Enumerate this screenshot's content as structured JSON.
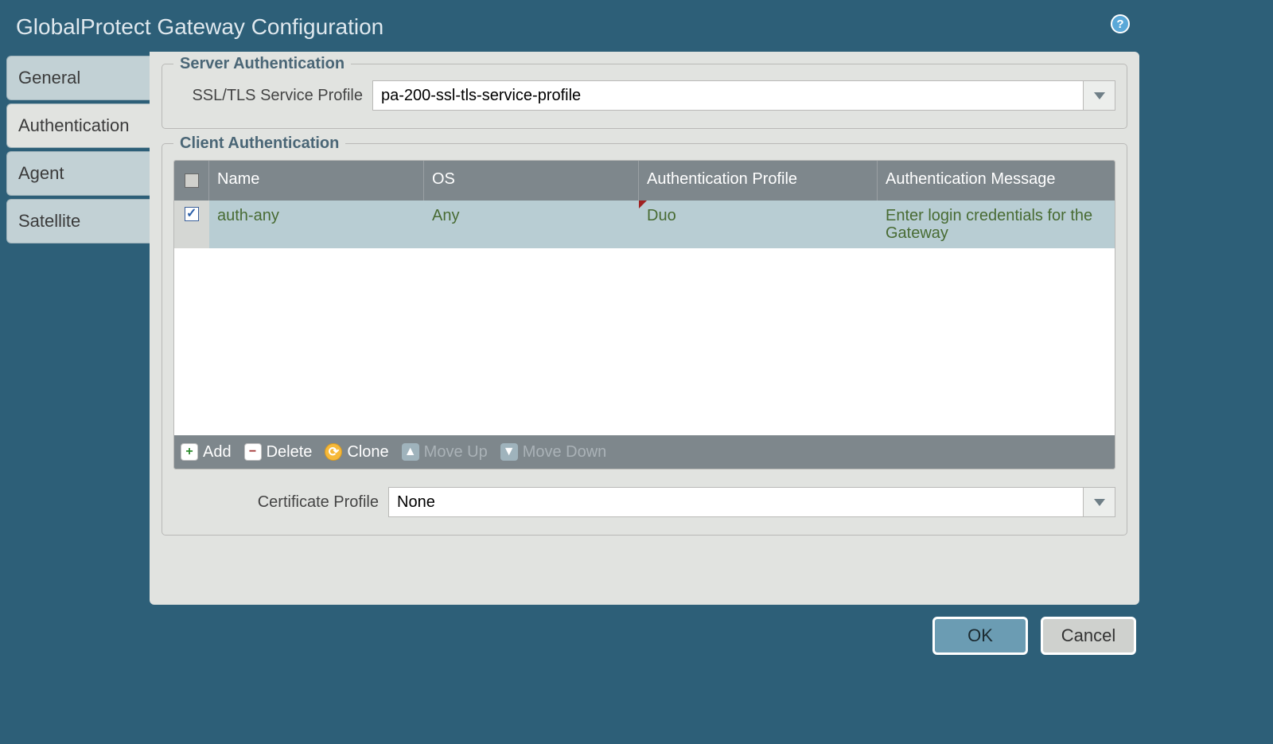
{
  "title": "GlobalProtect Gateway Configuration",
  "tabs": {
    "general": "General",
    "authentication": "Authentication",
    "agent": "Agent",
    "satellite": "Satellite"
  },
  "server_auth": {
    "legend": "Server Authentication",
    "ssl_label": "SSL/TLS Service Profile",
    "ssl_value": "pa-200-ssl-tls-service-profile"
  },
  "client_auth": {
    "legend": "Client Authentication",
    "columns": {
      "name": "Name",
      "os": "OS",
      "auth_profile": "Authentication Profile",
      "auth_message": "Authentication Message"
    },
    "rows": [
      {
        "name": "auth-any",
        "os": "Any",
        "auth_profile": "Duo",
        "auth_message": "Enter login credentials for the Gateway"
      }
    ],
    "toolbar": {
      "add": "Add",
      "delete": "Delete",
      "clone": "Clone",
      "move_up": "Move Up",
      "move_down": "Move Down"
    }
  },
  "cert_profile": {
    "label": "Certificate Profile",
    "value": "None"
  },
  "buttons": {
    "ok": "OK",
    "cancel": "Cancel"
  }
}
